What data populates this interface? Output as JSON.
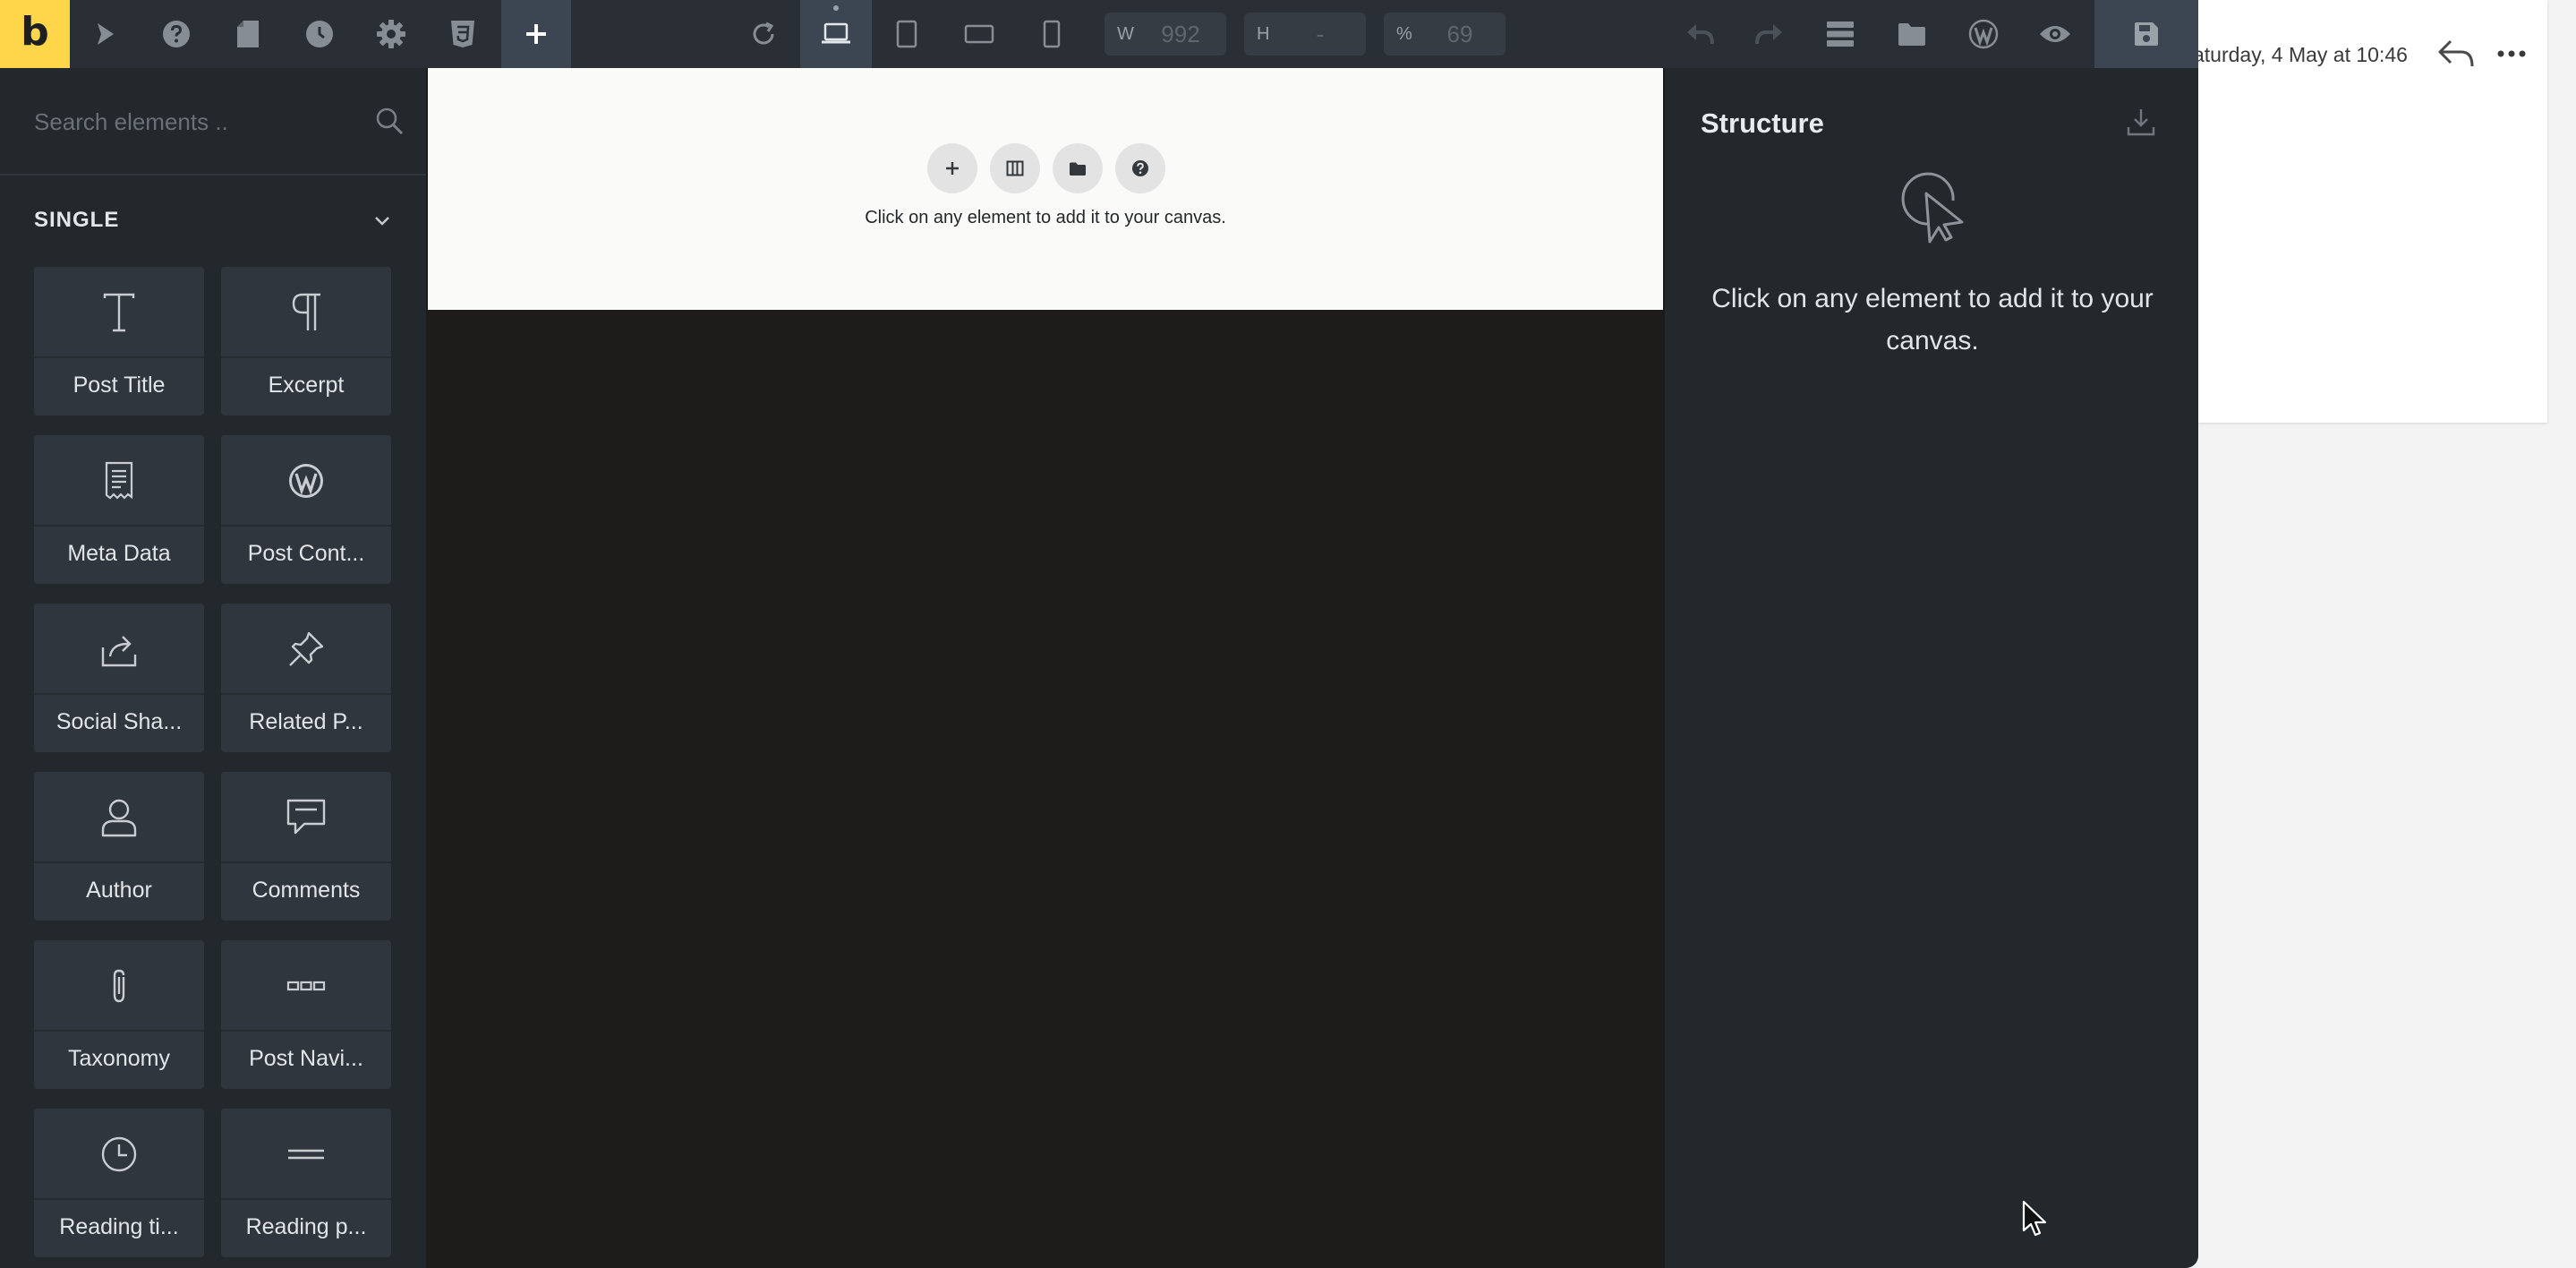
{
  "toolbar": {
    "logo_letter": "b",
    "width_label": "W",
    "width_value": "992",
    "height_label": "H",
    "height_value": "-",
    "scale_label": "%",
    "scale_value": "69"
  },
  "elements_panel": {
    "search_placeholder": "Search elements ..",
    "group_title": "SINGLE",
    "items": [
      {
        "label": "Post Title",
        "icon": "text-icon"
      },
      {
        "label": "Excerpt",
        "icon": "pilcrow-icon"
      },
      {
        "label": "Meta Data",
        "icon": "receipt-icon"
      },
      {
        "label": "Post Cont...",
        "icon": "wordpress-icon"
      },
      {
        "label": "Social Sha...",
        "icon": "share-icon"
      },
      {
        "label": "Related P...",
        "icon": "pin-icon"
      },
      {
        "label": "Author",
        "icon": "user-icon"
      },
      {
        "label": "Comments",
        "icon": "comment-icon"
      },
      {
        "label": "Taxonomy",
        "icon": "paperclip-icon"
      },
      {
        "label": "Post Navi...",
        "icon": "dots-icon"
      },
      {
        "label": "Reading ti...",
        "icon": "clock-icon"
      },
      {
        "label": "Reading p...",
        "icon": "lines-icon"
      }
    ]
  },
  "canvas": {
    "hint": "Click on any element to add it to your canvas."
  },
  "structure": {
    "title": "Structure",
    "hint": "Click on any element to add it to your canvas."
  },
  "background_window": {
    "date": "aturday, 4 May at 10:46"
  },
  "colors": {
    "brand": "#ffd54a",
    "toolbar": "#2a2f35",
    "panel": "#23282d",
    "canvas_dark": "#1d1c1b"
  }
}
